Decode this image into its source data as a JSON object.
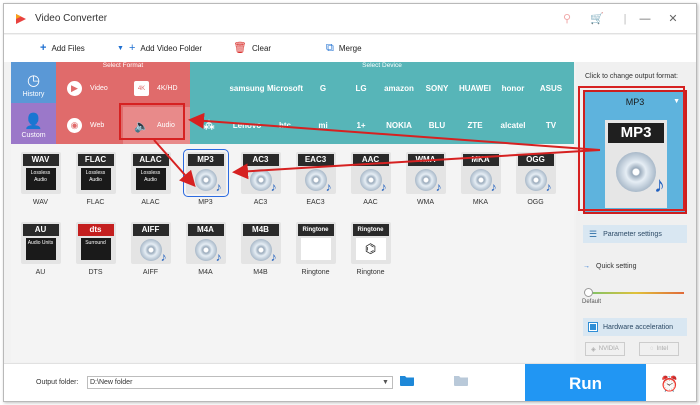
{
  "window": {
    "title": "Video Converter",
    "controls": [
      "pin-icon",
      "cart-icon",
      "minimize-icon",
      "close-icon"
    ]
  },
  "toolbar": {
    "add_files": "Add Files",
    "add_video_folder": "Add Video Folder",
    "clear": "Clear",
    "merge": "Merge"
  },
  "panel_headers": {
    "select_format": "Select Format",
    "select_device": "Select Device"
  },
  "categories": {
    "history": "History",
    "custom": "Custom"
  },
  "format_options": {
    "video": "Video",
    "hd": "4K/HD",
    "web": "Web",
    "audio": "Audio"
  },
  "brands_row1": [
    "samsung",
    "Microsoft",
    "G",
    "LG",
    "amazon",
    "SONY",
    "HUAWEI",
    "honor",
    "ASUS"
  ],
  "brands_row2": [
    "Lenovo",
    "htc",
    "mi",
    "1+",
    "NOKIA",
    "BLU",
    "ZTE",
    "alcatel",
    "TV"
  ],
  "formats": [
    {
      "tag": "WAV",
      "sub": "Lossless Audio",
      "label": "WAV"
    },
    {
      "tag": "FLAC",
      "sub": "Lossless Audio",
      "label": "FLAC"
    },
    {
      "tag": "ALAC",
      "sub": "Lossless Audio",
      "label": "ALAC"
    },
    {
      "tag": "MP3",
      "sub": "",
      "label": "MP3"
    },
    {
      "tag": "AC3",
      "sub": "",
      "label": "AC3"
    },
    {
      "tag": "EAC3",
      "sub": "",
      "label": "EAC3"
    },
    {
      "tag": "AAC",
      "sub": "",
      "label": "AAC"
    },
    {
      "tag": "WMA",
      "sub": "",
      "label": "WMA"
    },
    {
      "tag": "MKA",
      "sub": "",
      "label": "MKA"
    },
    {
      "tag": "OGG",
      "sub": "",
      "label": "OGG"
    },
    {
      "tag": "AU",
      "sub": "Audio Units",
      "label": "AU"
    },
    {
      "tag": "dts",
      "sub": "Surround",
      "label": "DTS"
    },
    {
      "tag": "AIFF",
      "sub": "",
      "label": "AIFF"
    },
    {
      "tag": "M4A",
      "sub": "",
      "label": "M4A"
    },
    {
      "tag": "M4B",
      "sub": "",
      "label": "M4B"
    },
    {
      "tag": "Ringtone",
      "sub": "",
      "label": "Ringtone"
    },
    {
      "tag": "Ringtone",
      "sub": "",
      "label": "Ringtone"
    }
  ],
  "right_panel": {
    "caption": "Click to change output format:",
    "selected_format": "MP3",
    "icon_tag": "MP3",
    "parameter_settings": "Parameter settings",
    "quick_setting": "Quick setting",
    "default_label": "Default",
    "hardware_acceleration": "Hardware acceleration",
    "gpu_nvidia": "NVIDIA",
    "gpu_intel": "Intel"
  },
  "bottom": {
    "output_folder_label": "Output folder:",
    "output_folder_value": "D:\\New folder",
    "run": "Run"
  },
  "colors": {
    "format_red": "#e06b6b",
    "device_teal": "#57b5b8",
    "history_blue": "#5a98d6",
    "custom_purple": "#9b78c9",
    "run_blue": "#2196f3",
    "highlight_red": "#d62121"
  }
}
